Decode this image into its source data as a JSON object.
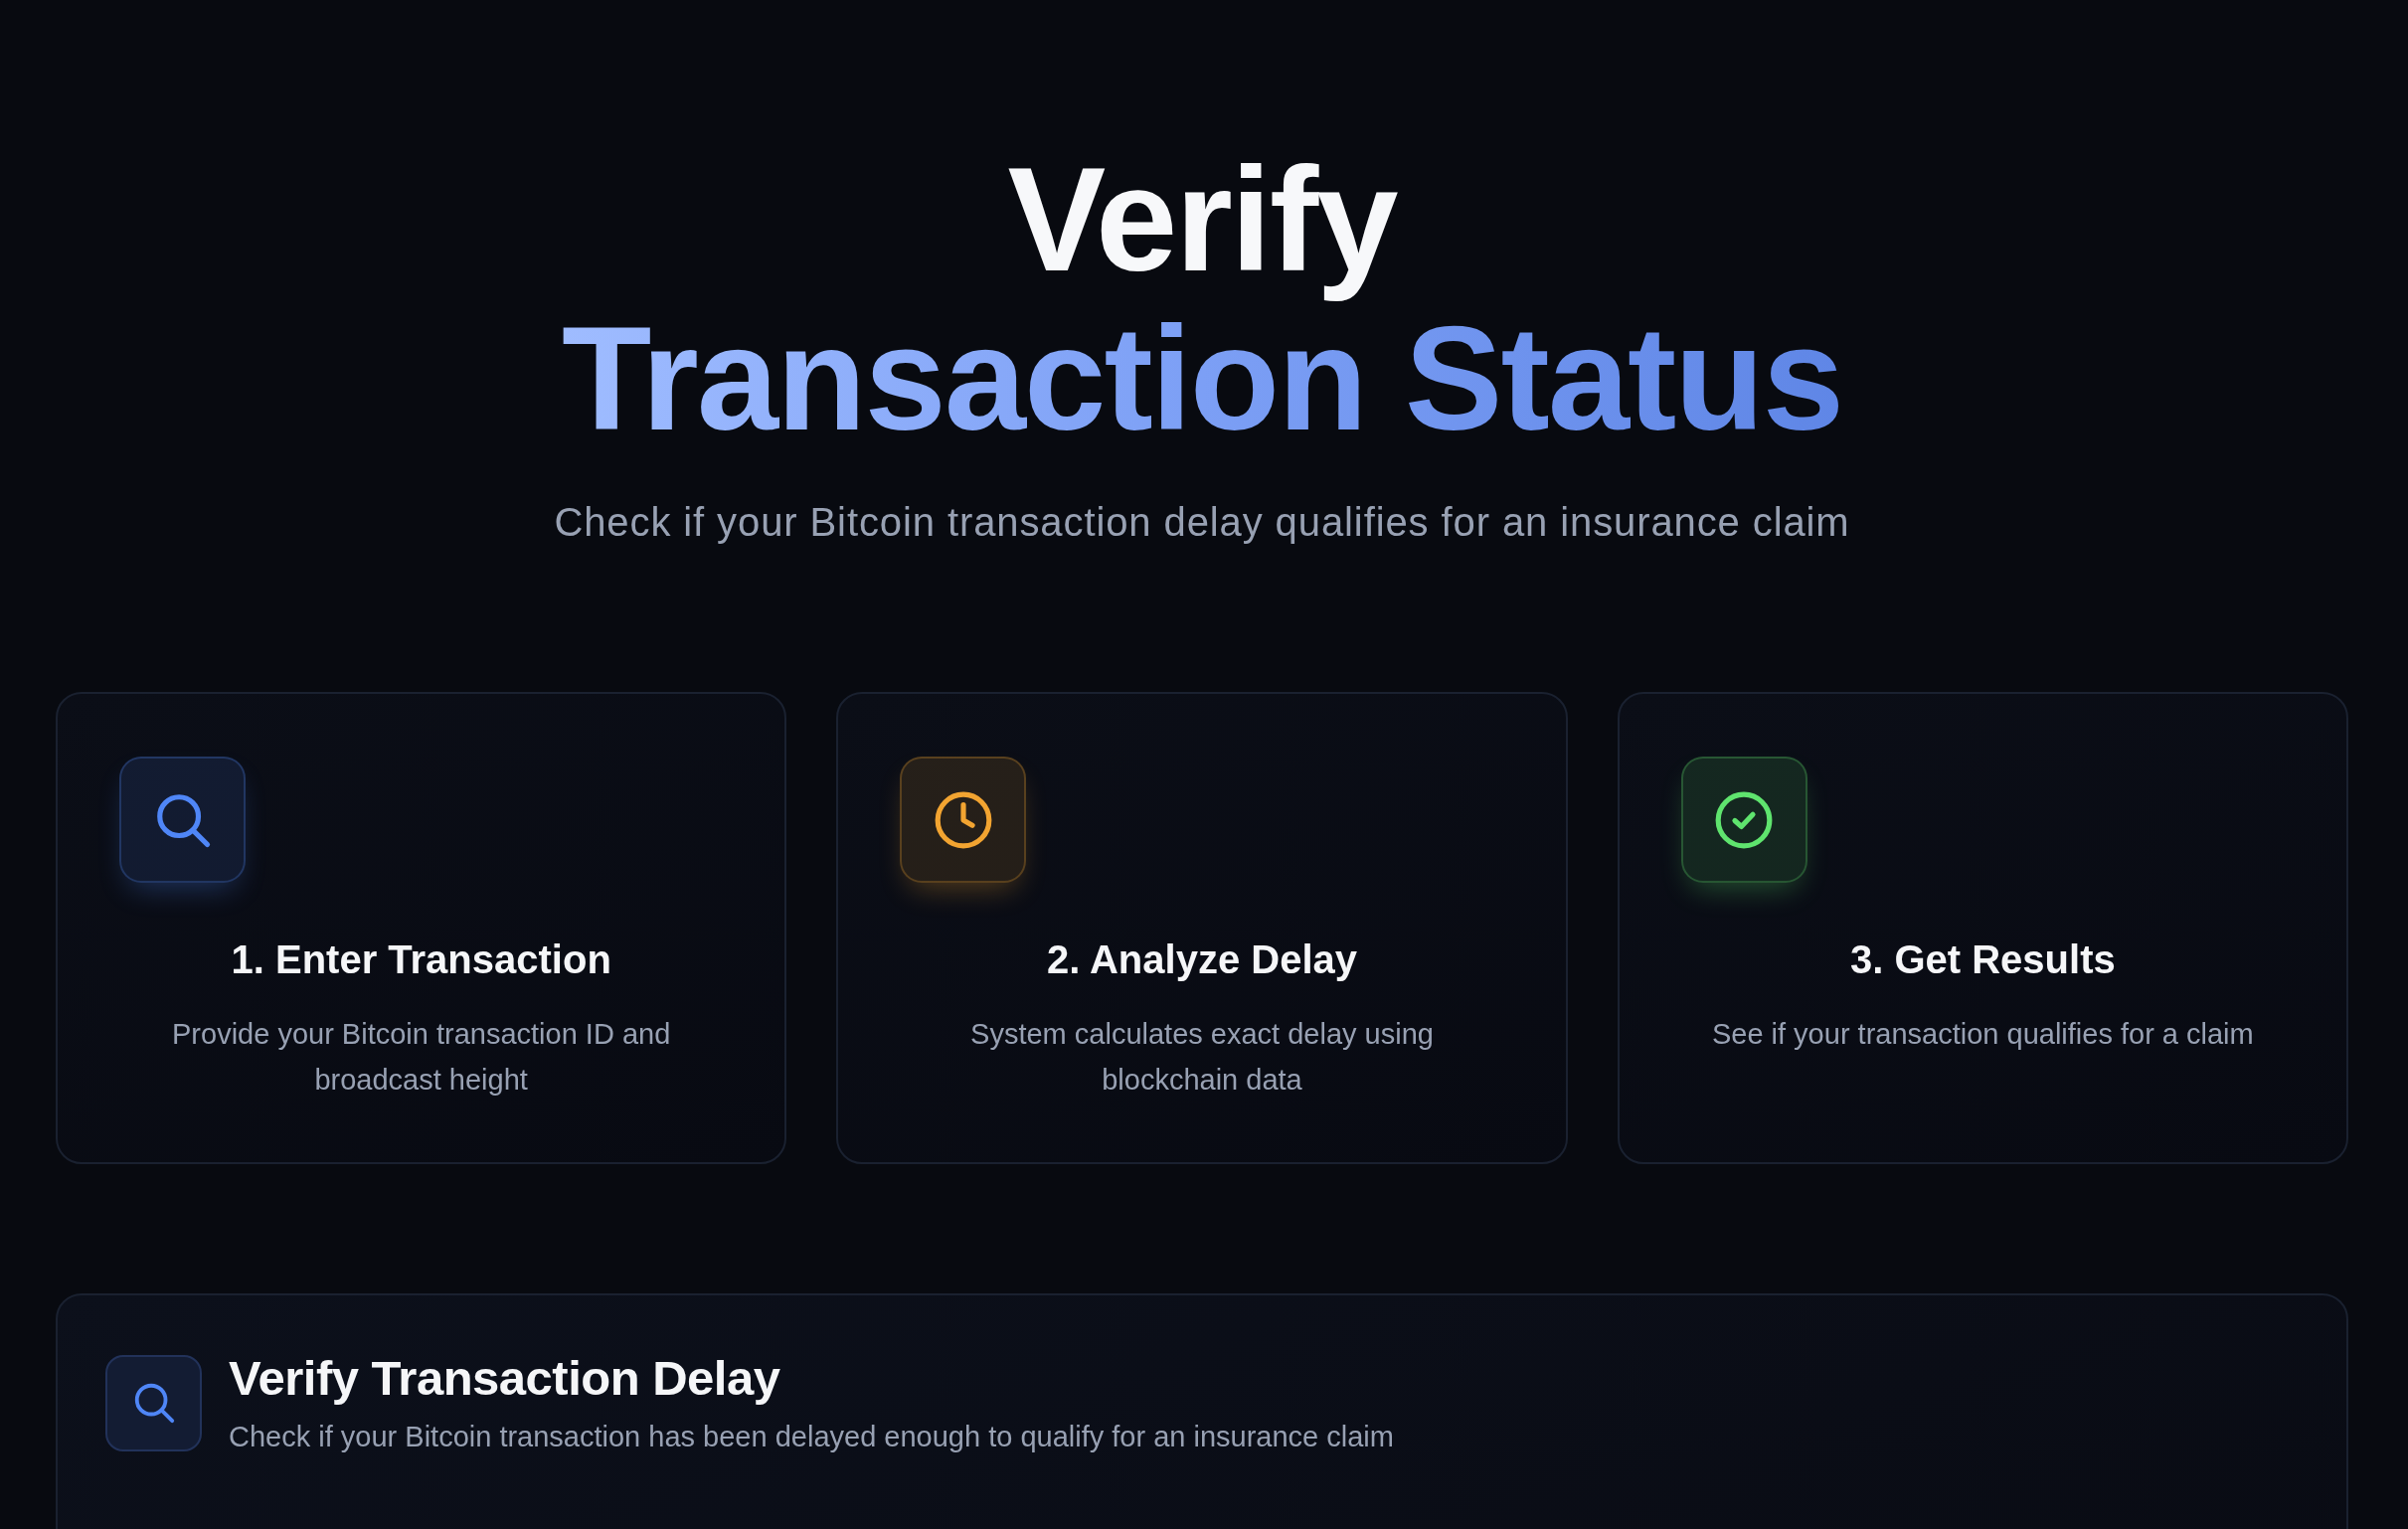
{
  "hero": {
    "title": "Verify",
    "title_highlight": "Transaction Status",
    "subtitle": "Check if your Bitcoin transaction delay qualifies for an insurance claim"
  },
  "steps": [
    {
      "title": "1. Enter Transaction",
      "description": "Provide your Bitcoin transaction ID and broadcast height",
      "color": "#4f86f7"
    },
    {
      "title": "2. Analyze Delay",
      "description": "System calculates exact delay using blockchain data",
      "color": "#f2a431"
    },
    {
      "title": "3. Get Results",
      "description": "See if your transaction qualifies for a claim",
      "color": "#5fe46e"
    }
  ],
  "verify_panel": {
    "title": "Verify Transaction Delay",
    "subtitle": "Check if your Bitcoin transaction has been delayed enough to qualify for an insurance claim"
  }
}
